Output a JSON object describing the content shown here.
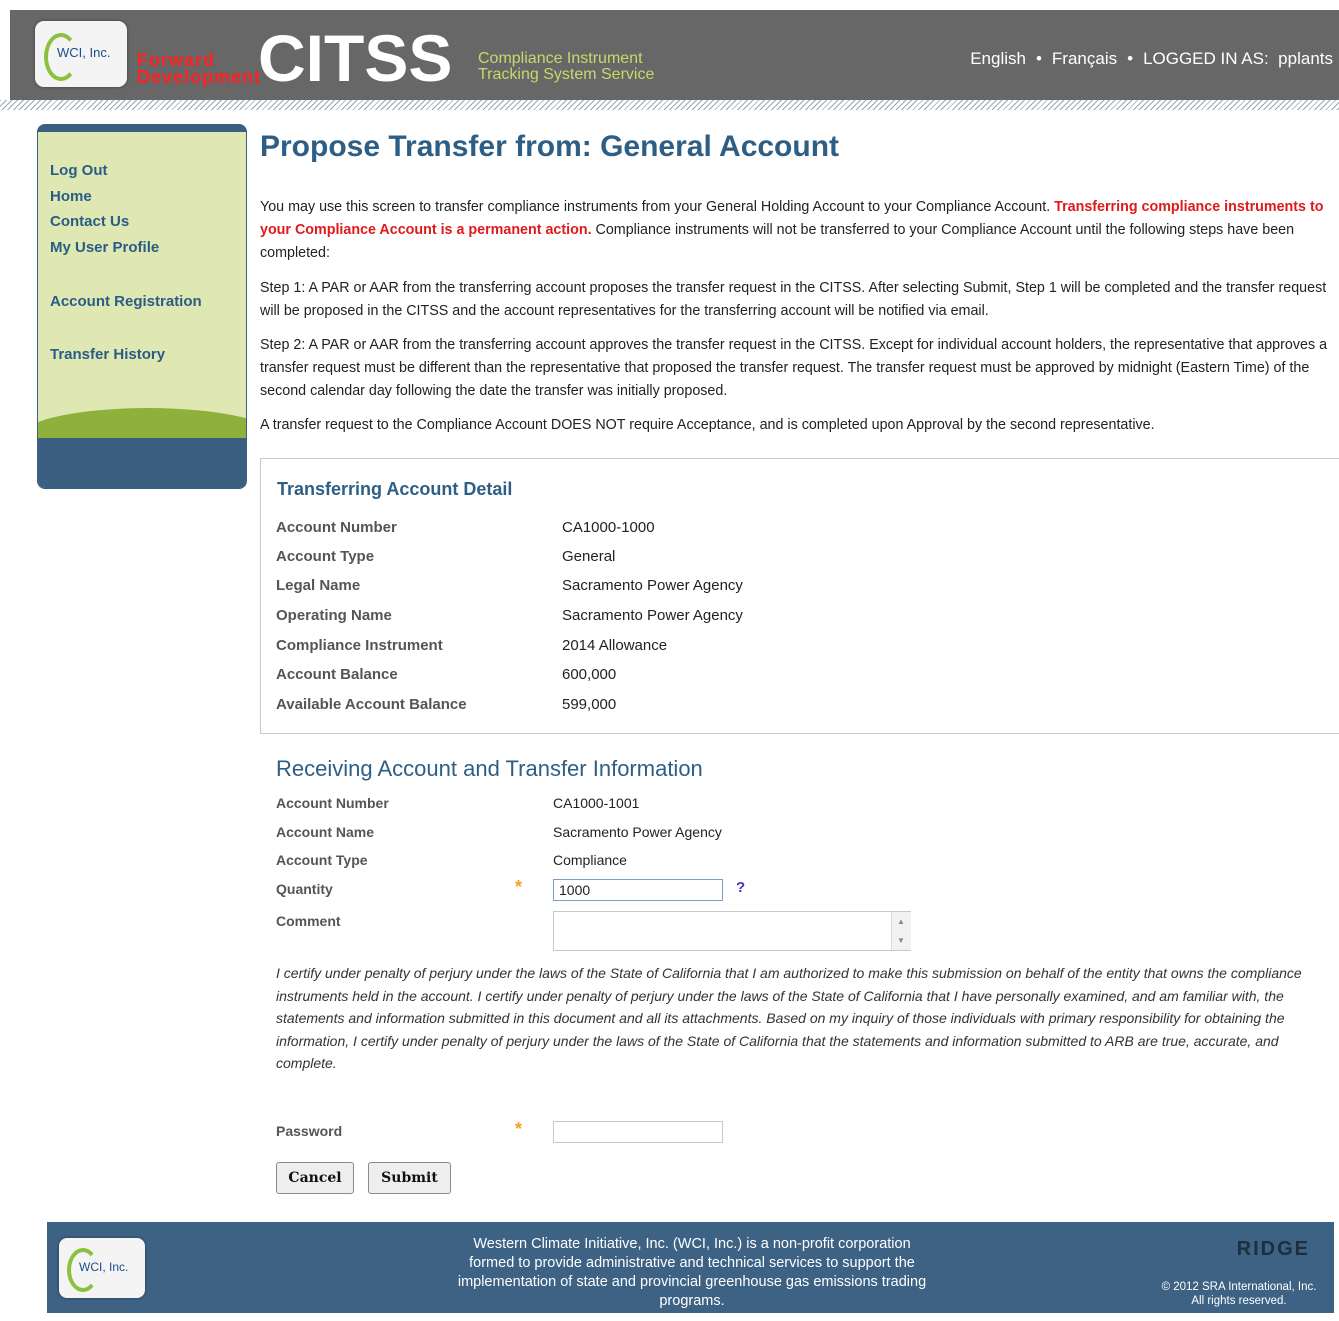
{
  "header": {
    "logo_text": "WCI, Inc.",
    "brand_tag": [
      "Forward",
      "Development"
    ],
    "app_name": "CITSS",
    "tagline": [
      "Compliance Instrument",
      "Tracking System Service"
    ],
    "lang_en": "English",
    "lang_fr": "Français",
    "logged_in_label": "LOGGED IN AS:",
    "username": "pplants"
  },
  "sidebar": {
    "items": [
      {
        "label": "Log Out"
      },
      {
        "label": "Home"
      },
      {
        "label": "Contact Us"
      },
      {
        "label": "My User Profile"
      },
      {
        "label": "Account Registration"
      },
      {
        "label": "Transfer History"
      }
    ]
  },
  "page": {
    "title": "Propose Transfer from: General Account",
    "intro_a": "You may use this screen to transfer compliance instruments from your General Holding Account to your Compliance Account. ",
    "intro_red": "Transferring compliance instruments to your Compliance Account is a permanent action.",
    "intro_b": " Compliance instruments will not be transferred to your Compliance Account until the following steps have been completed:",
    "step1": "Step 1: A PAR or AAR from the transferring account proposes the transfer request in the CITSS. After selecting Submit, Step 1 will be completed and the transfer request will be proposed in the CITSS and the account representatives for the transferring account will be notified via email.",
    "step2": "Step 2: A PAR or AAR from the transferring account approves the transfer request in the CITSS. Except for individual account holders, the representative that approves a transfer request must be different than the representative that proposed the transfer request. The transfer request must be approved by midnight (Eastern Time) of the second calendar day following the date the transfer was initially proposed.",
    "note": "A transfer request to the Compliance Account DOES NOT require Acceptance, and is completed upon Approval by the second representative."
  },
  "transferring": {
    "title": "Transferring Account Detail",
    "rows": [
      {
        "label": "Account Number",
        "value": "CA1000-1000"
      },
      {
        "label": "Account Type",
        "value": "General"
      },
      {
        "label": "Legal Name",
        "value": "Sacramento Power Agency"
      },
      {
        "label": "Operating Name",
        "value": "Sacramento Power Agency"
      },
      {
        "label": "Compliance Instrument",
        "value": "2014 Allowance"
      },
      {
        "label": "Account Balance",
        "value": "600,000"
      },
      {
        "label": "Available Account Balance",
        "value": "599,000"
      }
    ]
  },
  "receiving": {
    "title": "Receiving Account and Transfer Information",
    "rows": [
      {
        "label": "Account Number",
        "value": "CA1000-1001"
      },
      {
        "label": "Account Name",
        "value": "Sacramento Power Agency"
      },
      {
        "label": "Account Type",
        "value": "Compliance"
      }
    ],
    "quantity_label": "Quantity",
    "quantity_value": "1000",
    "required_mark": "*",
    "help_mark": "?",
    "comment_label": "Comment",
    "comment_value": "",
    "certification": "I certify under penalty of perjury under the laws of the State of California that I am authorized to make this submission on behalf of the entity that owns the compliance instruments held in the account. I certify under penalty of perjury under the laws of the State of California that I have personally examined, and am familiar with, the statements and information submitted in this document and all its attachments. Based on my inquiry of those individuals with primary responsibility for obtaining the information, I certify under penalty of perjury under the laws of the State of California that the statements and information submitted to ARB are true, accurate, and complete.",
    "password_label": "Password",
    "password_value": "",
    "cancel_label": "Cancel",
    "submit_label": "Submit"
  },
  "footer": {
    "logo_text": "WCI, Inc.",
    "text": "Western Climate Initiative, Inc. (WCI, Inc.) is a non-profit corporation formed to provide administrative and technical services to support the implementation of state and provincial greenhouse gas emissions trading programs.",
    "ridge": "RIDGE",
    "copyright": "© 2012 SRA International, Inc.",
    "rights": "All rights reserved."
  },
  "colors": {
    "header_bg": "#676767",
    "brand_red": "#ff2020",
    "title_blue": "#2d5f86",
    "sidebar_bg": "#dfe7b3",
    "footer_bg": "#3d6284"
  }
}
